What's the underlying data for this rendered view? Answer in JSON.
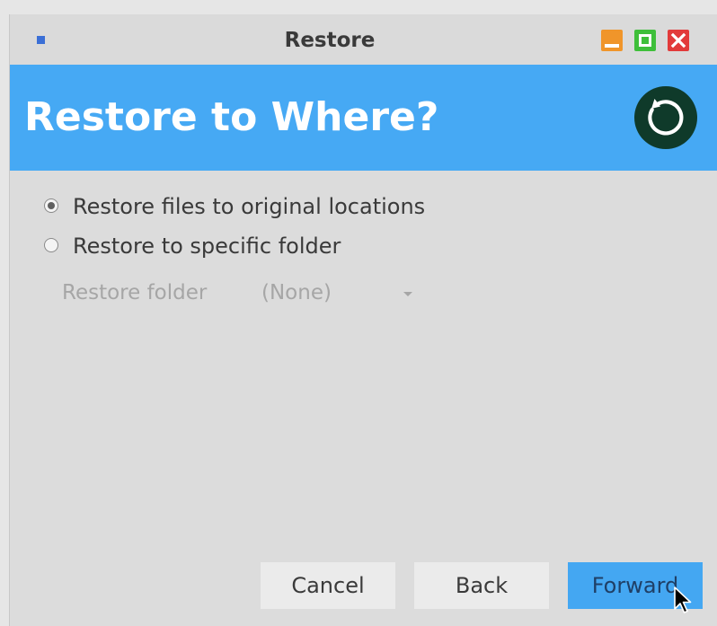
{
  "window": {
    "title": "Restore",
    "controls": {
      "minimize_icon": "minimize-icon",
      "maximize_icon": "maximize-icon",
      "close_icon": "close-icon"
    }
  },
  "banner": {
    "heading": "Restore to Where?",
    "icon": "restore-icon",
    "background_color": "#46a9f4"
  },
  "options": [
    {
      "label": "Restore files to original locations",
      "selected": true
    },
    {
      "label": "Restore to specific folder",
      "selected": false
    }
  ],
  "restore_folder": {
    "label": "Restore folder",
    "value": "(None)",
    "disabled": true
  },
  "buttons": {
    "cancel": "Cancel",
    "back": "Back",
    "forward": "Forward"
  }
}
